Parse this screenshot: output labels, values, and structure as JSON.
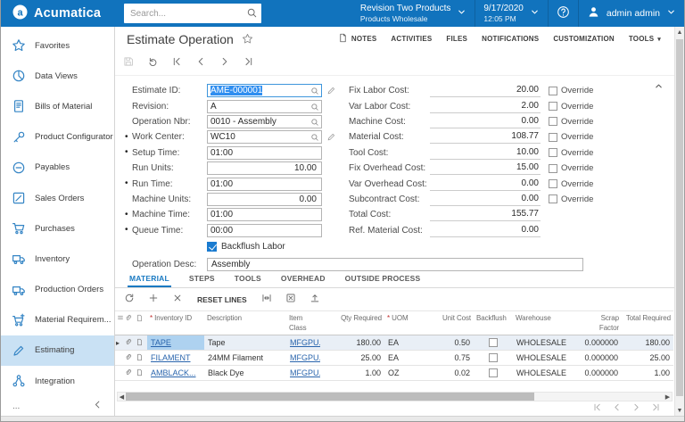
{
  "header": {
    "logo_text": "Acumatica",
    "search_placeholder": "Search...",
    "company": "Revision Two Products",
    "branch": "Products Wholesale",
    "date": "9/17/2020",
    "time": "12:05 PM",
    "user": "admin admin"
  },
  "sidebar": {
    "items": [
      {
        "label": "Favorites",
        "icon": "star"
      },
      {
        "label": "Data Views",
        "icon": "pie"
      },
      {
        "label": "Bills of Material",
        "icon": "bill"
      },
      {
        "label": "Product Configurator",
        "icon": "wrench"
      },
      {
        "label": "Payables",
        "icon": "minus-circle"
      },
      {
        "label": "Sales Orders",
        "icon": "pencil-square"
      },
      {
        "label": "Purchases",
        "icon": "cart"
      },
      {
        "label": "Inventory",
        "icon": "truck"
      },
      {
        "label": "Production Orders",
        "icon": "truck"
      },
      {
        "label": "Material Requirem...",
        "icon": "cart-plus"
      },
      {
        "label": "Estimating",
        "icon": "pencil",
        "active": true
      },
      {
        "label": "Integration",
        "icon": "nodes"
      }
    ],
    "more_label": "...",
    "collapse_icon": "chevron-left"
  },
  "page": {
    "title": "Estimate Operation",
    "links": [
      {
        "label": "NOTES",
        "icon": "note"
      },
      {
        "label": "ACTIVITIES"
      },
      {
        "label": "FILES"
      },
      {
        "label": "NOTIFICATIONS"
      },
      {
        "label": "CUSTOMIZATION"
      },
      {
        "label": "TOOLS",
        "caret": true
      }
    ],
    "toolbar": [
      {
        "icon": "save",
        "disabled": true
      },
      {
        "icon": "undo"
      },
      {
        "icon": "first"
      },
      {
        "icon": "prev"
      },
      {
        "icon": "next"
      },
      {
        "icon": "last"
      }
    ]
  },
  "form": {
    "left": [
      {
        "label": "Estimate ID:",
        "value": "AME-000001",
        "lookup": true,
        "pencil": true,
        "focused": true,
        "selected_text": true
      },
      {
        "label": "Revision:",
        "value": "A",
        "lookup": true
      },
      {
        "label": "Operation Nbr:",
        "value": "0010 - Assembly",
        "lookup": true
      },
      {
        "label": "Work Center:",
        "value": "WC10",
        "required": true,
        "lookup": true,
        "pencil": true
      },
      {
        "label": "Setup Time:",
        "value": "01:00",
        "required": true
      },
      {
        "label": "Run Units:",
        "value": "10.00",
        "align": "right"
      },
      {
        "label": "Run Time:",
        "value": "01:00",
        "required": true
      },
      {
        "label": "Machine Units:",
        "value": "0.00",
        "align": "right"
      },
      {
        "label": "Machine Time:",
        "value": "01:00",
        "required": true
      },
      {
        "label": "Queue Time:",
        "value": "00:00",
        "required": true
      }
    ],
    "backflush_label": "Backflush Labor",
    "backflush_checked": true,
    "operation_desc_label": "Operation Desc:",
    "operation_desc_value": "Assembly",
    "override_label": "Override",
    "costs": [
      {
        "label": "Fix Labor Cost:",
        "value": "20.00",
        "override": true
      },
      {
        "label": "Var Labor Cost:",
        "value": "2.00",
        "override": true
      },
      {
        "label": "Machine Cost:",
        "value": "0.00",
        "override": true
      },
      {
        "label": "Material Cost:",
        "value": "108.77",
        "override": true
      },
      {
        "label": "Tool Cost:",
        "value": "10.00",
        "override": true
      },
      {
        "label": "Fix Overhead Cost:",
        "value": "15.00",
        "override": true
      },
      {
        "label": "Var Overhead Cost:",
        "value": "0.00",
        "override": true
      },
      {
        "label": "Subcontract Cost:",
        "value": "0.00",
        "override": true
      },
      {
        "label": "Total Cost:",
        "value": "155.77",
        "override": false
      },
      {
        "label": "Ref. Material Cost:",
        "value": "0.00",
        "override": false
      }
    ]
  },
  "tabs": [
    {
      "label": "MATERIAL",
      "active": true
    },
    {
      "label": "STEPS"
    },
    {
      "label": "TOOLS"
    },
    {
      "label": "OVERHEAD"
    },
    {
      "label": "OUTSIDE PROCESS"
    }
  ],
  "grid": {
    "toolbar": [
      {
        "icon": "refresh"
      },
      {
        "icon": "plus"
      },
      {
        "icon": "cross"
      },
      {
        "label": "RESET LINES"
      },
      {
        "icon": "fit"
      },
      {
        "icon": "excel"
      },
      {
        "icon": "upload"
      }
    ],
    "columns": [
      {
        "key": "inventory_id",
        "label": "Inventory ID",
        "required": true,
        "width": 64,
        "link": true
      },
      {
        "key": "description",
        "label": "Description",
        "width": 92
      },
      {
        "key": "item_class",
        "label": "Item Class",
        "width": 38,
        "link": true
      },
      {
        "key": "qty_required",
        "label": "Qty Required",
        "width": 72,
        "align": "right"
      },
      {
        "key": "uom",
        "label": "UOM",
        "required": true,
        "width": 43
      },
      {
        "key": "unit_cost",
        "label": "Unit Cost",
        "width": 57,
        "align": "right"
      },
      {
        "key": "backflush",
        "label": "Backflush",
        "width": 44,
        "type": "checkbox"
      },
      {
        "key": "warehouse",
        "label": "Warehouse",
        "width": 74
      },
      {
        "key": "scrap_factor",
        "label": "Scrap Factor",
        "width": 48,
        "align": "right"
      },
      {
        "key": "total_required",
        "label": "Total Required",
        "width": 58,
        "align": "right"
      }
    ],
    "rows": [
      {
        "selected": true,
        "inventory_id": "TAPE",
        "description": "Tape",
        "item_class": "MFGPU...",
        "qty_required": "180.00",
        "uom": "EA",
        "unit_cost": "0.50",
        "backflush": false,
        "warehouse": "WHOLESALE",
        "scrap_factor": "0.000000",
        "total_required": "180.00"
      },
      {
        "inventory_id": "FILAMENT",
        "description": "24MM Filament",
        "item_class": "MFGPU...",
        "qty_required": "25.00",
        "uom": "EA",
        "unit_cost": "0.75",
        "backflush": false,
        "warehouse": "WHOLESALE",
        "scrap_factor": "0.000000",
        "total_required": "25.00"
      },
      {
        "inventory_id": "AMBLACK...",
        "description": "Black Dye",
        "item_class": "MFGPU...",
        "qty_required": "1.00",
        "uom": "OZ",
        "unit_cost": "0.02",
        "backflush": false,
        "warehouse": "WHOLESALE",
        "scrap_factor": "0.000000",
        "total_required": "1.00"
      }
    ]
  }
}
